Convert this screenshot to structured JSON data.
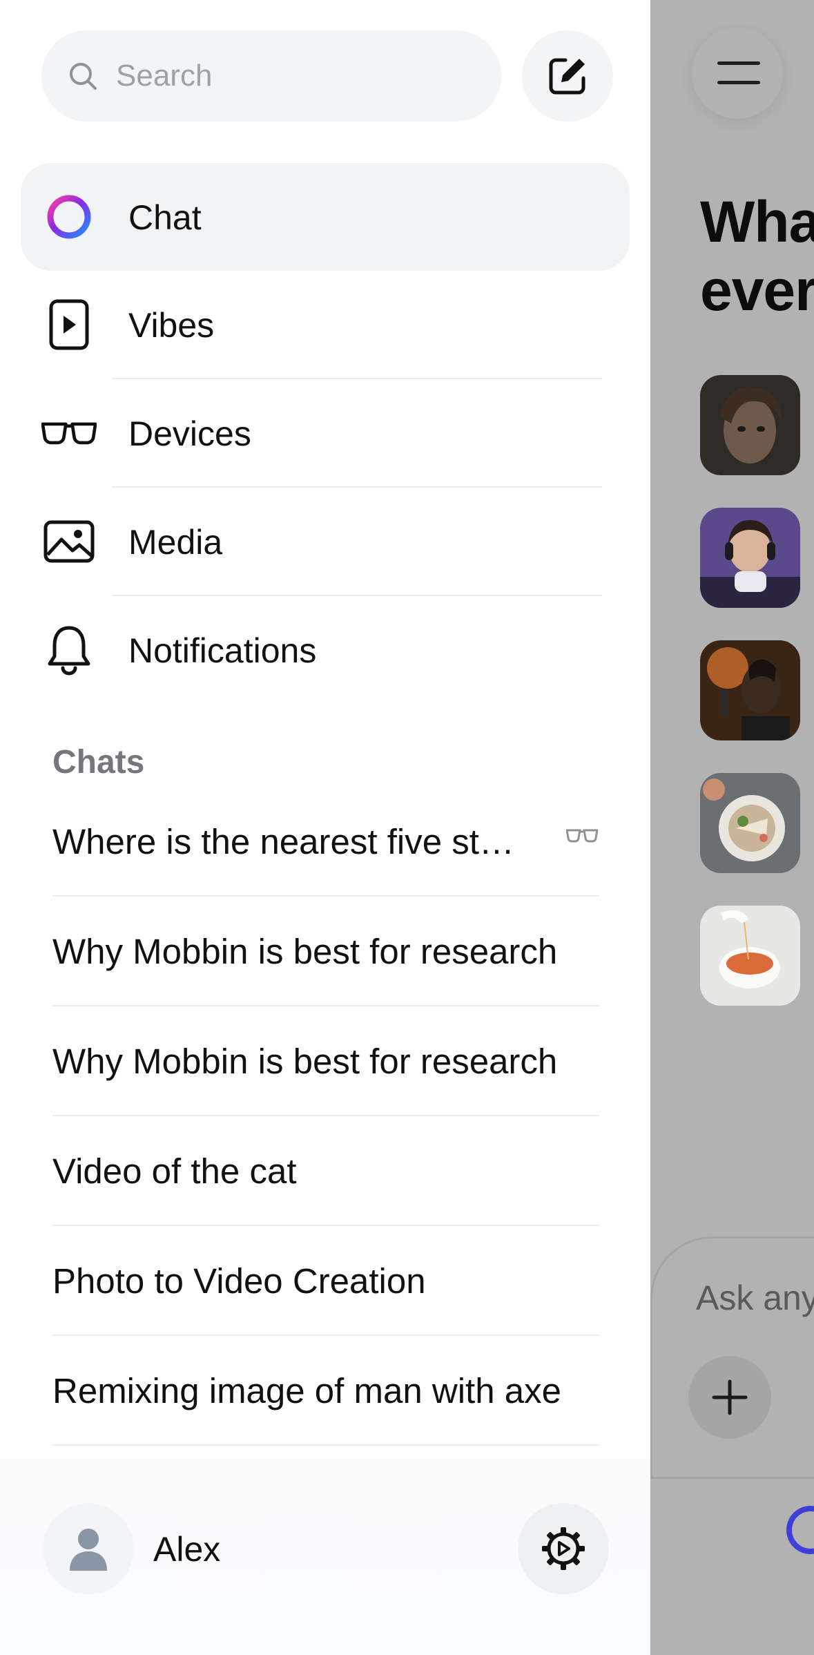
{
  "search": {
    "placeholder": "Search"
  },
  "nav": {
    "items": [
      {
        "label": "Chat",
        "icon": "meta-ai-ring-icon",
        "active": true
      },
      {
        "label": "Vibes",
        "icon": "play-video-icon",
        "active": false
      },
      {
        "label": "Devices",
        "icon": "glasses-icon",
        "active": false
      },
      {
        "label": "Media",
        "icon": "image-icon",
        "active": false
      },
      {
        "label": "Notifications",
        "icon": "bell-icon",
        "active": false
      }
    ]
  },
  "chats": {
    "title": "Chats",
    "items": [
      {
        "text": "Where is the nearest five st…",
        "badge_icon": "glasses-icon"
      },
      {
        "text": "Why Mobbin is best for research"
      },
      {
        "text": "Why Mobbin is best for research"
      },
      {
        "text": "Video of the cat"
      },
      {
        "text": "Photo to Video Creation"
      },
      {
        "text": "Remixing image of man with axe"
      }
    ]
  },
  "user": {
    "name": "Alex"
  },
  "background": {
    "heading_line1": "Wha",
    "heading_line2": "ever",
    "input_placeholder": "Ask any"
  },
  "colors": {
    "drawer_bg": "#ffffff",
    "active_item_bg": "#f2f3f5",
    "section_title": "#75777c",
    "overlay": "#b2b2b2",
    "accent_gradient": [
      "#1e90ff",
      "#8a2be2",
      "#ff3fa4"
    ]
  }
}
